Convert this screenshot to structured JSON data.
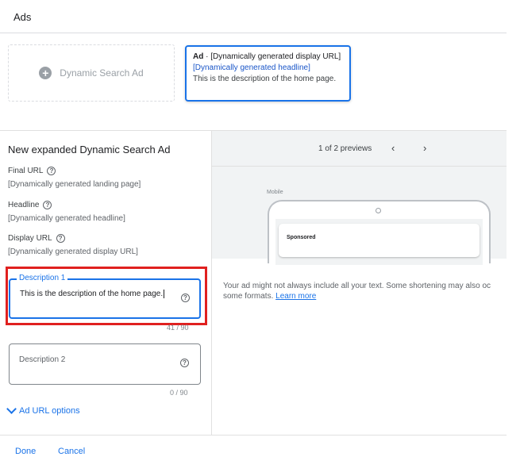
{
  "header": {
    "title": "Ads"
  },
  "new_ad_card": {
    "label": "Dynamic Search Ad",
    "icon": "plus-icon"
  },
  "ad_card": {
    "badge": "Ad",
    "separator": " · ",
    "display_url": "[Dynamically generated display URL]",
    "headline": "[Dynamically generated headline]",
    "description": "This is the description of the home page."
  },
  "editor": {
    "title": "New expanded Dynamic Search Ad",
    "final_url": {
      "label": "Final URL",
      "value": "[Dynamically generated landing page]"
    },
    "headline": {
      "label": "Headline",
      "value": "[Dynamically generated headline]"
    },
    "display_url": {
      "label": "Display URL",
      "value": "[Dynamically generated display URL]"
    },
    "description1": {
      "label": "Description 1",
      "value": "This is the description of the home page.",
      "counter": "41 / 90"
    },
    "description2": {
      "label": "Description 2",
      "value": "",
      "counter": "0 / 90"
    },
    "ad_url_options": "Ad URL options"
  },
  "preview": {
    "count": "1 of 2 previews",
    "prev": "‹",
    "next": "›",
    "device_label": "Mobile",
    "sponsored": "Sponsored",
    "disclaimer_line1": "Your ad might not always include all your text. Some shortening may also oc",
    "disclaimer_line2": "some formats. ",
    "learn_more": "Learn more"
  },
  "footer": {
    "done": "Done",
    "cancel": "Cancel"
  },
  "colors": {
    "accent": "#1a73e8",
    "highlight": "#e0201f"
  }
}
